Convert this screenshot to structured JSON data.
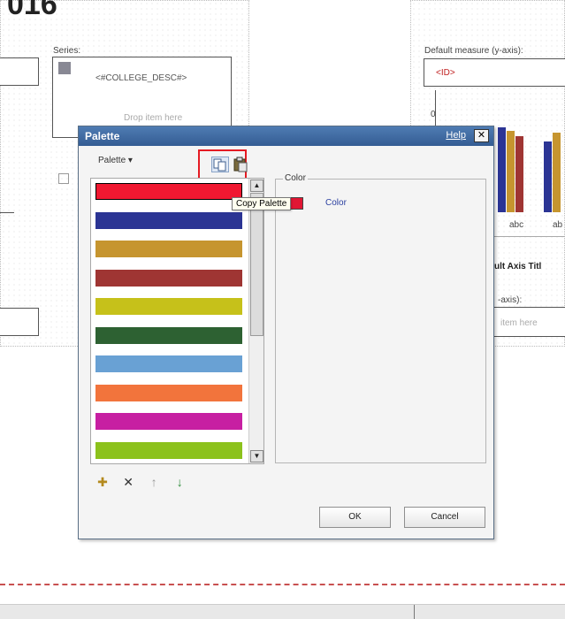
{
  "background": {
    "big_title": "016",
    "series_label": "Series:",
    "series_value": "<#COLLEGE_DESC#>",
    "drop_item_hint": "Drop item here",
    "default_measure_label": "Default measure (y-axis):",
    "default_measure_value": "<ID>",
    "chart_tick_top": "0",
    "chart_tick_1": "abc",
    "chart_tick_2": "ab",
    "axis_title_label": "ult Axis Titl",
    "axis_field_label": "-axis):",
    "axis_drop_hint": "item here"
  },
  "dialog": {
    "title": "Palette",
    "help_label": "Help",
    "close_glyph": "✕",
    "palette_menu_label": "Palette ▾",
    "toolbar": {
      "copy_icon_glyph": "⧉",
      "paste_icon_glyph": "📋",
      "tooltip": "Copy Palette"
    },
    "swatches": [
      {
        "color": "#f01831"
      },
      {
        "color": "#2b3494"
      },
      {
        "color": "#c6952f"
      },
      {
        "color": "#9f3533"
      },
      {
        "color": "#c6c11a"
      },
      {
        "color": "#2d6132"
      },
      {
        "color": "#69a1d4"
      },
      {
        "color": "#f2743c"
      },
      {
        "color": "#c71fa2"
      },
      {
        "color": "#8cc21c"
      }
    ],
    "selected_index": 0,
    "scroll_up_glyph": "▲",
    "scroll_down_glyph": "▼",
    "color_group_label": "Color",
    "color_link_label": "Color",
    "selected_color": "#e11633",
    "bottom_tools": [
      {
        "name": "add-color-icon",
        "glyph": "✚"
      },
      {
        "name": "delete-icon",
        "glyph": "✕"
      },
      {
        "name": "move-up-icon",
        "glyph": "↑"
      },
      {
        "name": "move-down-icon",
        "glyph": "↓"
      }
    ],
    "ok_label": "OK",
    "cancel_label": "Cancel"
  }
}
